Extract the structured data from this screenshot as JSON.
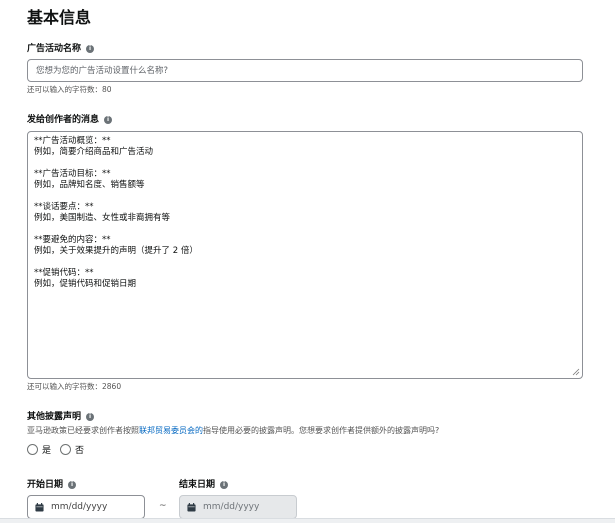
{
  "page": {
    "title": "基本信息"
  },
  "campaign_name": {
    "label": "广告活动名称",
    "placeholder": "您想为您的广告活动设置什么名称?",
    "hint": "还可以输入的字符数：80"
  },
  "creator_message": {
    "label": "发给创作者的消息",
    "lines": [
      "**广告活动概览：**",
      "例如，简要介绍商品和广告活动",
      "",
      "**广告活动目标：**",
      "例如，品牌知名度、销售额等",
      "",
      "**谈话要点：**",
      "例如，美国制造、女性或非裔拥有等",
      "",
      "**要避免的内容：**",
      "例如，关于效果提升的声明（提升了 2 倍）",
      "",
      "**促销代码：**",
      "例如，促销代码和促销日期"
    ],
    "hint": "还可以输入的字符数：2860"
  },
  "disclosure": {
    "label": "其他披露声明",
    "desc_before": "亚马逊政策已经要求创作者按照",
    "desc_link": "联邦贸易委员会的",
    "desc_after": "指导使用必要的披露声明。您想要求创作者提供额外的披露声明吗?",
    "option_yes": "是",
    "option_no": "否"
  },
  "dates": {
    "start_label": "开始日期",
    "end_label": "结束日期",
    "start_placeholder": "mm/dd/yyyy",
    "end_placeholder": "mm/dd/yyyy",
    "separator": "~"
  },
  "icons": {
    "info": "info-icon",
    "calendar": "calendar-icon",
    "resize": "resize-handle-icon"
  },
  "colors": {
    "link": "#0066c0",
    "info_icon": "#6b7277",
    "disabled_bg": "#e6e8ea"
  }
}
